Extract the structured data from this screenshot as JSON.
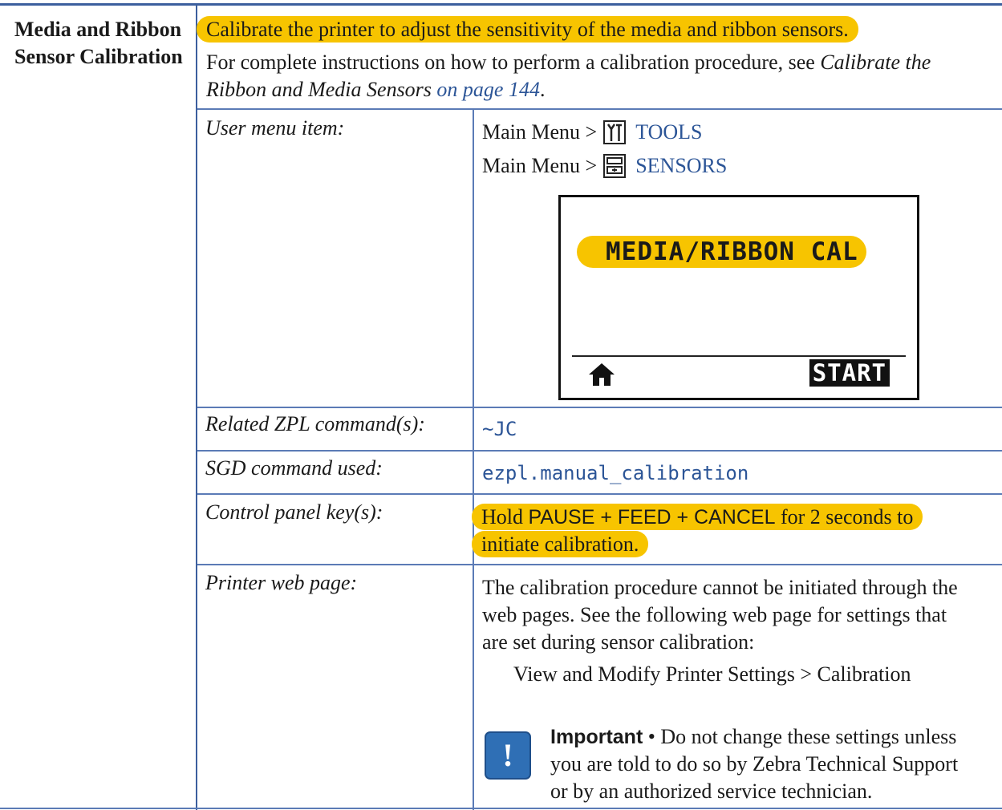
{
  "section_title": "Media and Ribbon Sensor Calibration",
  "intro": {
    "highlight": "Calibrate the printer to adjust the sensitivity of the media and ribbon sensors.",
    "line1_plain": "For complete instructions on how to perform a calibration procedure, see ",
    "line1_italic": "Calibrate the",
    "line2_italic": "Ribbon and Media Sensors",
    "line2_link": " on page 144",
    "line2_end": "."
  },
  "rows": {
    "user_menu": {
      "label": "User menu item:",
      "menu1_prefix": "Main Menu >",
      "menu1_link": "TOOLS",
      "menu1_icon": "tools-icon",
      "menu2_prefix": "Main Menu >",
      "menu2_link": "SENSORS",
      "menu2_icon": "sensors-icon",
      "lcd_title": "MEDIA/RIBBON CAL",
      "lcd_start": "START",
      "lcd_home_icon": "home-icon"
    },
    "zpl": {
      "label": "Related ZPL command(s):",
      "value": "~JC"
    },
    "sgd": {
      "label": "SGD command used:",
      "value": "ezpl.manual_calibration"
    },
    "control_panel": {
      "label": "Control panel key(s):",
      "hold": "Hold ",
      "keys": "PAUSE + FEED + CANCEL",
      "rest1": " for 2 seconds to",
      "rest2": "initiate calibration."
    },
    "web_page": {
      "label": "Printer web page:",
      "line1": "The calibration procedure cannot be initiated through the",
      "line2": "web pages. See the following web page for settings that",
      "line3": "are set during sensor calibration:",
      "path": "View and Modify Printer Settings > Calibration",
      "important_label": "Important",
      "important_bullet": " • ",
      "important1": "Do not change these settings unless",
      "important2": "you are told to do so by Zebra Technical Support",
      "important3": "or by an authorized service technician.",
      "important_icon_glyph": "!"
    }
  },
  "colors": {
    "highlight": "#f7c400",
    "link": "#2c5597",
    "rule": "#3c5f9e",
    "important_icon": "#2f6fb5"
  }
}
